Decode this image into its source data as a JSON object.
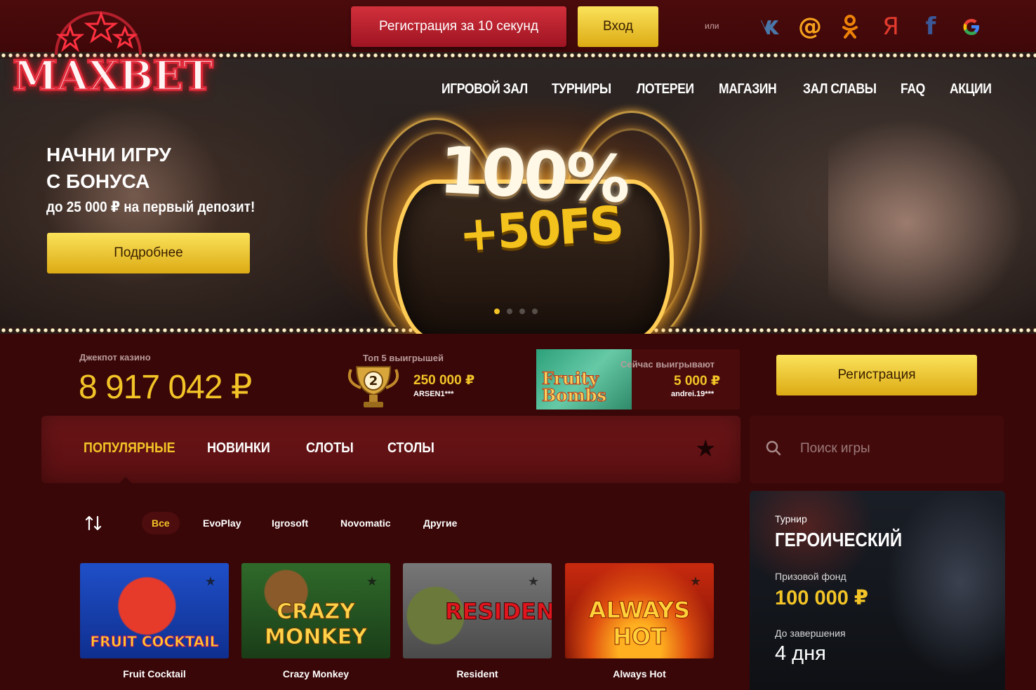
{
  "brand": {
    "logo_text": "MAXBET"
  },
  "header": {
    "register_label": "Регистрация за 10 секунд",
    "login_label": "Вход",
    "or_label": "или",
    "socials": [
      {
        "name": "vk-icon",
        "glyph": "vk",
        "color": "#4a76a8"
      },
      {
        "name": "mail-ru-icon",
        "glyph": "@",
        "color": "#f6a21d"
      },
      {
        "name": "odnoklassniki-icon",
        "glyph": "ок",
        "color": "#ee8208"
      },
      {
        "name": "yandex-icon",
        "glyph": "Я",
        "color": "#e23b2e"
      },
      {
        "name": "facebook-icon",
        "glyph": "f",
        "color": "#3b5998"
      },
      {
        "name": "google-icon",
        "glyph": "G",
        "color": "#4285f4"
      }
    ]
  },
  "nav": {
    "items": [
      "ИГРОВОЙ ЗАЛ",
      "ТУРНИРЫ",
      "ЛОТЕРЕИ",
      "МАГАЗИН",
      "ЗАЛ СЛАВЫ",
      "FAQ",
      "АКЦИИ"
    ]
  },
  "hero": {
    "title_line1": "НАЧНИ ИГРУ",
    "title_line2": "С БОНУСА",
    "subtitle": "до 25 000 ₽ на первый депозит!",
    "button_label": "Подробнее",
    "promo_percent": "100%",
    "promo_fs": "+50FS",
    "slides_count": 4,
    "active_slide": 0
  },
  "stats": {
    "jackpot_label": "Джекпот казино",
    "jackpot_value": "8 917 042 ₽",
    "top5_label": "Топ 5 выигрышей",
    "top5_place": "2",
    "top5_amount": "250 000 ₽",
    "top5_user": "ARSEN1***",
    "now_label": "Сейчас выигрывают",
    "now_game_line1": "Fruity",
    "now_game_line2": "Bombs",
    "now_amount": "5 000 ₽",
    "now_user": "andrei.19***",
    "register_label": "Регистрация"
  },
  "categories": {
    "tabs": [
      "ПОПУЛЯРНЫЕ",
      "НОВИНКИ",
      "СЛОТЫ",
      "СТОЛЫ"
    ],
    "active": 0
  },
  "search": {
    "placeholder": "Поиск игры"
  },
  "filters": {
    "items": [
      "Все",
      "EvoPlay",
      "Igrosoft",
      "Novomatic",
      "Другие"
    ],
    "active": 0
  },
  "games": [
    {
      "name": "Fruit Cocktail",
      "art_text": "FRUIT COCKTAIL"
    },
    {
      "name": "Crazy Monkey",
      "art_text": "CRAZY MONKEY"
    },
    {
      "name": "Resident",
      "art_text": "RESIDENT"
    },
    {
      "name": "Always Hot",
      "art_text": "ALWAYS HOT"
    }
  ],
  "tournament": {
    "label": "Турнир",
    "name": "ГЕРОИЧЕСКИЙ",
    "prize_label": "Призовой фонд",
    "prize": "100 000 ₽",
    "end_label": "До завершения",
    "end_value": "4 дня"
  }
}
